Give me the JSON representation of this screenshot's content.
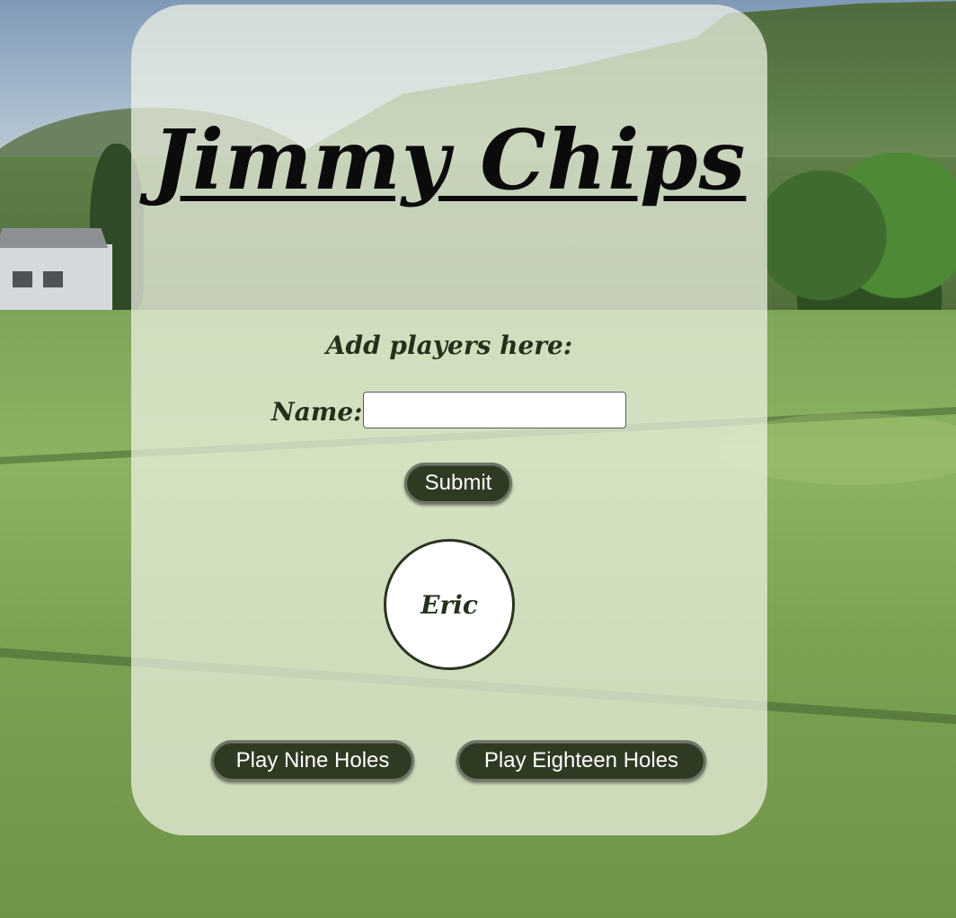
{
  "app": {
    "title": "Jimmy Chips"
  },
  "form": {
    "heading": "Add players here:",
    "name_label": "Name:",
    "name_value": "",
    "name_placeholder": "",
    "submit_label": "Submit"
  },
  "players": [
    {
      "name": "Eric"
    }
  ],
  "actions": {
    "nine_label": "Play Nine Holes",
    "eighteen_label": "Play Eighteen Holes"
  },
  "colors": {
    "button_bg": "#2f3a22",
    "text_dark": "#24301c",
    "card_bg": "#f0f4e6"
  }
}
